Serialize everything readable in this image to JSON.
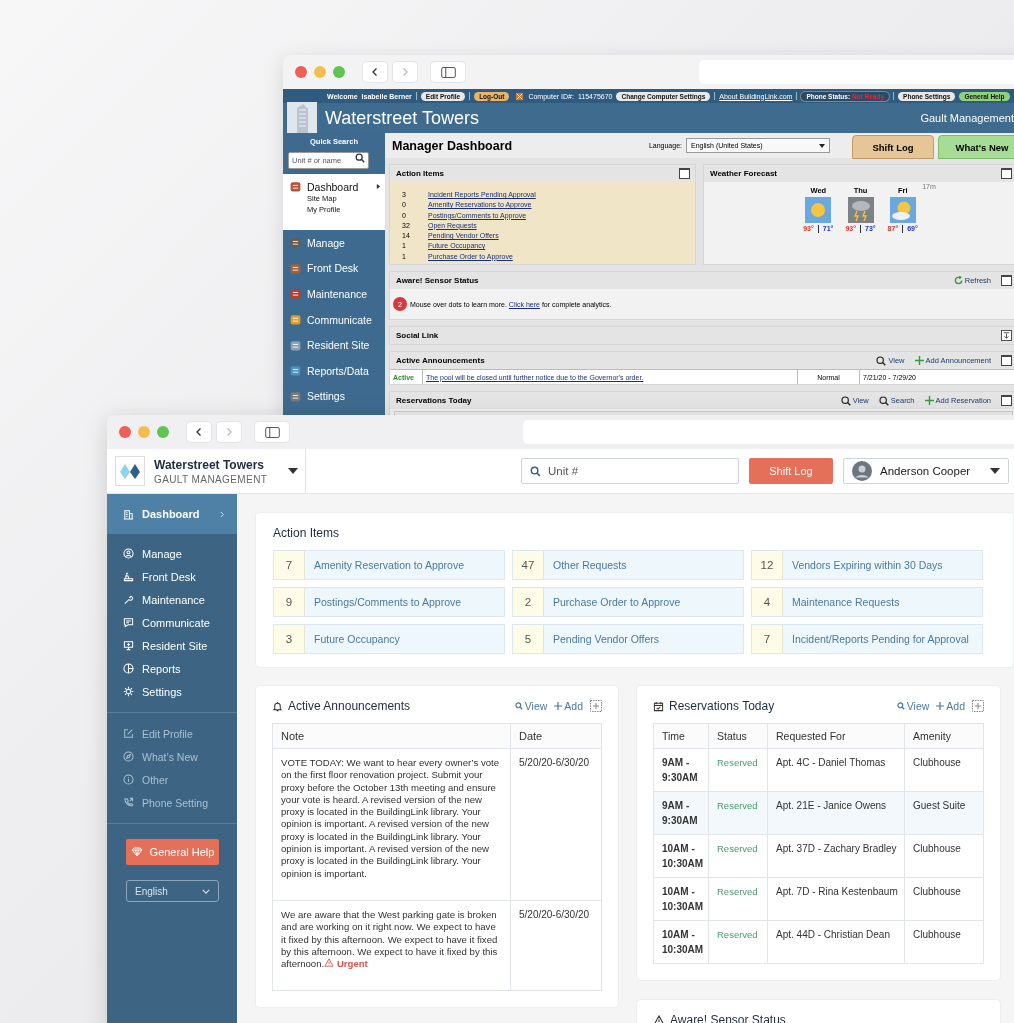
{
  "back_window": {
    "top_bar": {
      "welcome": "Welcome",
      "user": "Isabelle Berner",
      "edit_profile": "Edit Profile",
      "logout": "Log-Out",
      "computer_id_label": "Computer ID#:",
      "computer_id": "115475670",
      "change_settings": "Change Computer Settings",
      "about_link": "About BuildingLink.com",
      "phone_status_label": "Phone Status:",
      "phone_status": "Not Ready",
      "phone_settings": "Phone Settings",
      "general_help": "General Help"
    },
    "site_title": "Waterstreet Towers",
    "company": "Gault Management",
    "quick_search": {
      "label": "Quick Search",
      "placeholder": "Unit # or name"
    },
    "sidebar": [
      {
        "label": "Dashboard",
        "selected": true,
        "children": [
          {
            "label": "Site Map"
          },
          {
            "label": "My Profile"
          }
        ]
      },
      {
        "label": "Manage",
        "selected": false
      },
      {
        "label": "Front Desk",
        "selected": false
      },
      {
        "label": "Maintenance",
        "selected": false
      },
      {
        "label": "Communicate",
        "selected": false
      },
      {
        "label": "Resident Site",
        "selected": false
      },
      {
        "label": "Reports/Data",
        "selected": false
      },
      {
        "label": "Settings",
        "selected": false
      }
    ],
    "page_title": "Manager Dashboard",
    "language": {
      "label": "Language:",
      "value": "English (United States)"
    },
    "header_buttons": [
      {
        "label": "Shift Log",
        "kind": "shift"
      },
      {
        "label": "What's New",
        "kind": "new"
      }
    ],
    "action_items": {
      "title": "Action Items",
      "rows": [
        {
          "count": "3",
          "label": "Incident Reports Pending Approval"
        },
        {
          "count": "0",
          "label": "Amenity Reservations to Approve"
        },
        {
          "count": "0",
          "label": "Postings/Comments to Approve"
        },
        {
          "count": "32",
          "label": "Open Requests"
        },
        {
          "count": "14",
          "label": "Pending Vendor Offers"
        },
        {
          "count": "1",
          "label": "Future Occupancy"
        },
        {
          "count": "1",
          "label": "Purchase Order to Approve"
        }
      ]
    },
    "weather": {
      "title": "Weather Forecast",
      "updated": "17m",
      "days": [
        {
          "day": "Wed",
          "kind": "sunny",
          "high": "93°",
          "low": "71°"
        },
        {
          "day": "Thu",
          "kind": "storm",
          "high": "93°",
          "low": "73°"
        },
        {
          "day": "Fri",
          "kind": "partly",
          "high": "87°",
          "low": "69°"
        }
      ]
    },
    "sensor": {
      "title": "Aware! Sensor Status",
      "refresh": "Refresh",
      "count": "2",
      "message": "Mouse over dots to learn more.",
      "link": "Click here",
      "message_after": "for complete analytics."
    },
    "social": {
      "title": "Social Link"
    },
    "announcements": {
      "title": "Active Announcements",
      "view": "View",
      "add": "Add Announcement",
      "rows": [
        {
          "status": "Active",
          "text": "The pool will be closed until further notice due to the Governor's order.",
          "priority": "Normal",
          "dates": "7/21/20 - 7/29/20"
        }
      ]
    },
    "reservations": {
      "title": "Reservations Today",
      "view": "View",
      "search": "Search",
      "add": "Add Reservation"
    }
  },
  "front_window": {
    "property": {
      "name": "Waterstreet Towers",
      "company": "GAULT MANAGEMENT"
    },
    "search": {
      "placeholder": "Unit #"
    },
    "shift_log": "Shift Log",
    "user": {
      "name": "Anderson Cooper"
    },
    "sidebar": {
      "nav": [
        {
          "label": "Dashboard",
          "selected": true
        },
        {
          "label": "Manage",
          "selected": false
        },
        {
          "label": "Front Desk",
          "selected": false
        },
        {
          "label": "Maintenance",
          "selected": false
        },
        {
          "label": "Communicate",
          "selected": false
        },
        {
          "label": "Resident Site",
          "selected": false
        },
        {
          "label": "Reports",
          "selected": false
        },
        {
          "label": "Settings",
          "selected": false
        }
      ],
      "links": [
        {
          "label": "Edit Profile"
        },
        {
          "label": "What’s New"
        },
        {
          "label": "Other"
        },
        {
          "label": "Phone Setting"
        }
      ],
      "help_button": "General Help",
      "language": {
        "value": "English"
      }
    },
    "action_items": {
      "title": "Action Items",
      "items": [
        {
          "count": "7",
          "label": "Amenity Reservation to Approve"
        },
        {
          "count": "47",
          "label": "Other Requests"
        },
        {
          "count": "12",
          "label": "Vendors Expiring within 30 Days"
        },
        {
          "count": "9",
          "label": "Postings/Comments to Approve"
        },
        {
          "count": "2",
          "label": "Purchase Order to Approve"
        },
        {
          "count": "4",
          "label": "Maintenance Requests"
        },
        {
          "count": "3",
          "label": "Future Occupancy"
        },
        {
          "count": "5",
          "label": "Pending Vendor Offers"
        },
        {
          "count": "7",
          "label": "Incident/Reports Pending for Approval"
        }
      ]
    },
    "announcements": {
      "title": "Active Announcements",
      "view": "View",
      "add": "Add",
      "columns": [
        "Note",
        "Date"
      ],
      "rows": [
        {
          "note": "VOTE TODAY: We want to hear every owner’s vote on the first floor renovation project. Submit your proxy before the October 13th meeting and ensure your vote is heard. A revised version of the new proxy is located in the BuildingLink library. Your opinion is important.  A revised version of the new proxy is located in the BuildingLink library. Your opinion is important. A revised version of the new proxy is located in the BuildingLink library. Your opinion is important.",
          "date": "5/20/20-6/30/20"
        },
        {
          "note": "We are aware that the West parking gate is broken and are working on it right now. We expect to have it fixed by this afternoon. We expect to have it fixed by this afternoon. We expect to have it fixed by this afternoon.",
          "tag": "Urgent",
          "date": "5/20/20-6/30/20"
        }
      ]
    },
    "reservations": {
      "title": "Reservations Today",
      "view": "View",
      "add": "Add",
      "columns": [
        "Time",
        "Status",
        "Requested For",
        "Amenity"
      ],
      "rows": [
        {
          "time": "9AM - 9:30AM",
          "status": "Reserved",
          "requested_for": "Apt. 4C - Daniel Thomas",
          "amenity": "Clubhouse",
          "selected": false
        },
        {
          "time": "9AM - 9:30AM",
          "status": "Reserved",
          "requested_for": "Apt. 21E - Janice Owens",
          "amenity": "Guest Suite",
          "selected": true
        },
        {
          "time": "10AM - 10:30AM",
          "status": "Reserved",
          "requested_for": "Apt. 37D - Zachary Bradley",
          "amenity": "Clubhouse",
          "selected": false
        },
        {
          "time": "10AM - 10:30AM",
          "status": "Reserved",
          "requested_for": "Apt. 7D - Rina Kestenbaum",
          "amenity": "Clubhouse",
          "selected": false
        },
        {
          "time": "10AM - 10:30AM",
          "status": "Reserved",
          "requested_for": "Apt. 44D - Christian Dean",
          "amenity": "Clubhouse",
          "selected": false
        }
      ]
    },
    "sensor": {
      "title": "Aware! Sensor Status"
    }
  }
}
